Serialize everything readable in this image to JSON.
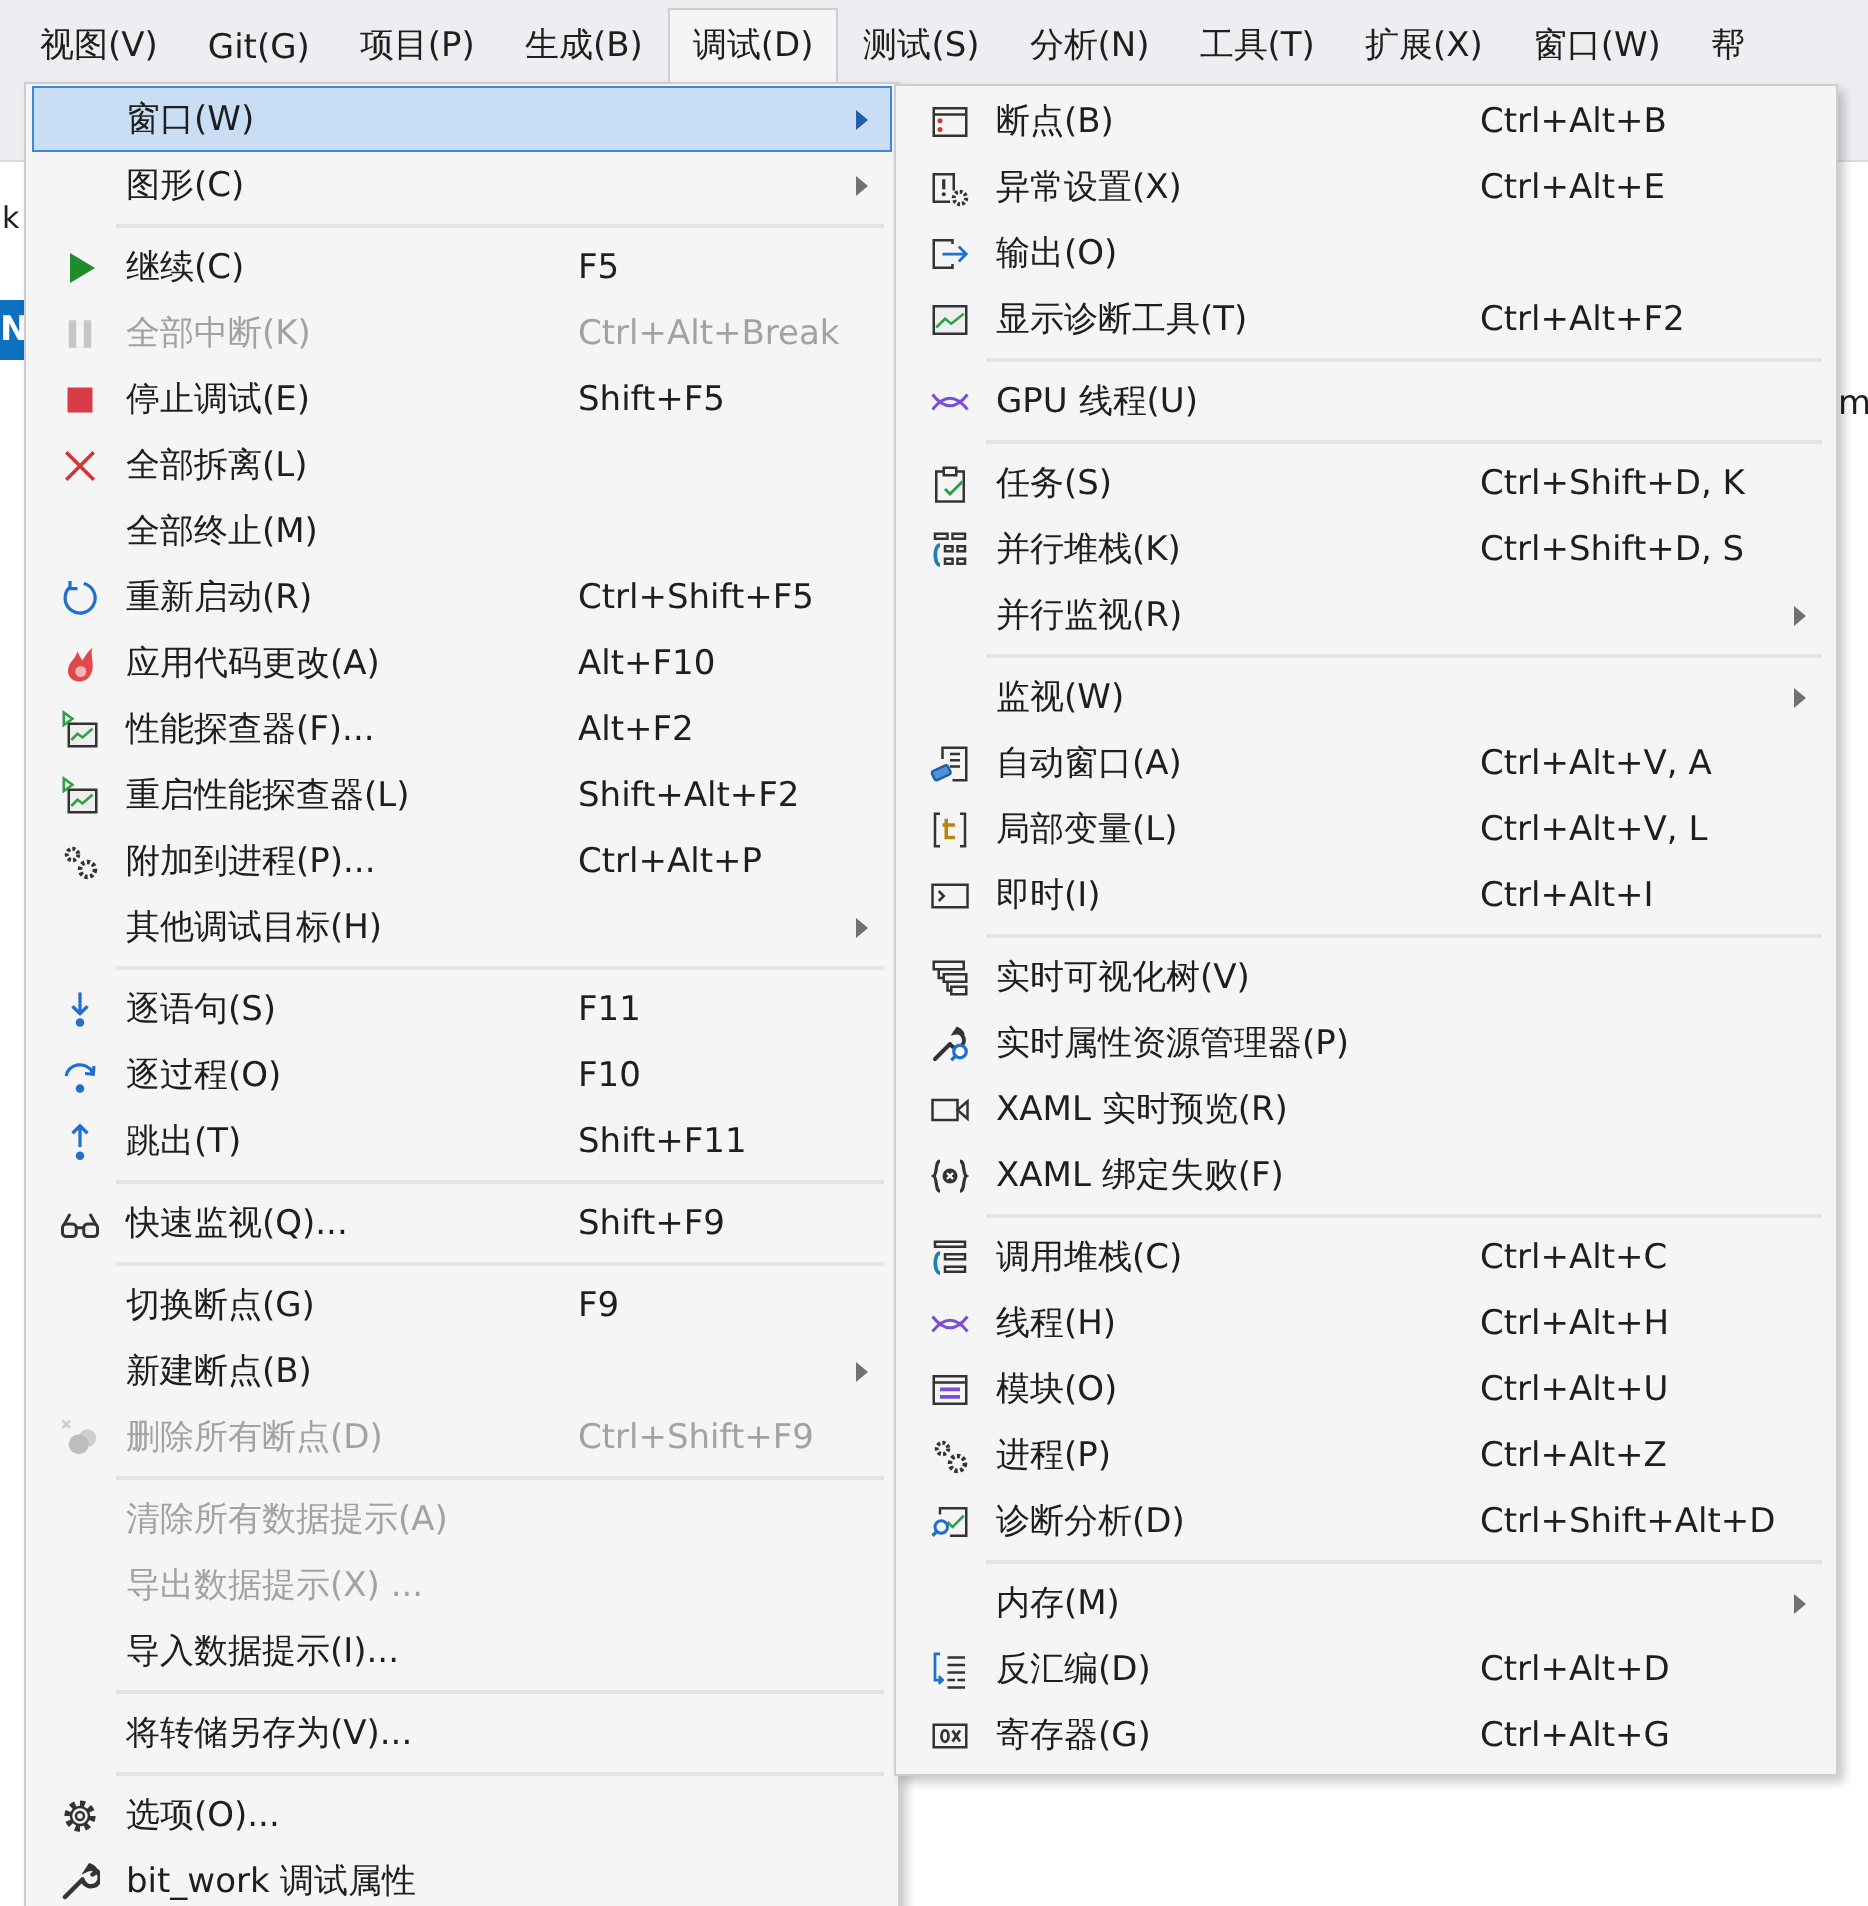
{
  "menubar": [
    {
      "label": "视图(V)",
      "selected": false
    },
    {
      "label": "Git(G)",
      "selected": false
    },
    {
      "label": "项目(P)",
      "selected": false
    },
    {
      "label": "生成(B)",
      "selected": false
    },
    {
      "label": "调试(D)",
      "selected": true
    },
    {
      "label": "测试(S)",
      "selected": false
    },
    {
      "label": "分析(N)",
      "selected": false
    },
    {
      "label": "工具(T)",
      "selected": false
    },
    {
      "label": "扩展(X)",
      "selected": false
    },
    {
      "label": "窗口(W)",
      "selected": false
    },
    {
      "label": "帮",
      "selected": false
    }
  ],
  "background_fragments": [
    "k",
    "N",
    "m"
  ],
  "debug_menu": {
    "items": [
      {
        "kind": "item",
        "label": "窗口(W)",
        "submenu": true,
        "selected": true,
        "disabled": false
      },
      {
        "kind": "item",
        "label": "图形(C)",
        "submenu": true,
        "selected": false,
        "disabled": false
      },
      {
        "kind": "separator"
      },
      {
        "kind": "item",
        "label": "继续(C)",
        "shortcut": "F5",
        "submenu": false,
        "selected": false,
        "disabled": false
      },
      {
        "kind": "item",
        "label": "全部中断(K)",
        "shortcut": "Ctrl+Alt+Break",
        "submenu": false,
        "selected": false,
        "disabled": true
      },
      {
        "kind": "item",
        "label": "停止调试(E)",
        "shortcut": "Shift+F5",
        "submenu": false,
        "selected": false,
        "disabled": false
      },
      {
        "kind": "item",
        "label": "全部拆离(L)",
        "submenu": false,
        "selected": false,
        "disabled": false
      },
      {
        "kind": "item",
        "label": "全部终止(M)",
        "submenu": false,
        "selected": false,
        "disabled": false
      },
      {
        "kind": "item",
        "label": "重新启动(R)",
        "shortcut": "Ctrl+Shift+F5",
        "submenu": false,
        "selected": false,
        "disabled": false
      },
      {
        "kind": "item",
        "label": "应用代码更改(A)",
        "shortcut": "Alt+F10",
        "submenu": false,
        "selected": false,
        "disabled": false
      },
      {
        "kind": "item",
        "label": "性能探查器(F)...",
        "shortcut": "Alt+F2",
        "submenu": false,
        "selected": false,
        "disabled": false
      },
      {
        "kind": "item",
        "label": "重启性能探查器(L)",
        "shortcut": "Shift+Alt+F2",
        "submenu": false,
        "selected": false,
        "disabled": false
      },
      {
        "kind": "item",
        "label": "附加到进程(P)...",
        "shortcut": "Ctrl+Alt+P",
        "submenu": false,
        "selected": false,
        "disabled": false
      },
      {
        "kind": "item",
        "label": "其他调试目标(H)",
        "submenu": true,
        "selected": false,
        "disabled": false
      },
      {
        "kind": "separator"
      },
      {
        "kind": "item",
        "label": "逐语句(S)",
        "shortcut": "F11",
        "submenu": false,
        "selected": false,
        "disabled": false
      },
      {
        "kind": "item",
        "label": "逐过程(O)",
        "shortcut": "F10",
        "submenu": false,
        "selected": false,
        "disabled": false
      },
      {
        "kind": "item",
        "label": "跳出(T)",
        "shortcut": "Shift+F11",
        "submenu": false,
        "selected": false,
        "disabled": false
      },
      {
        "kind": "separator"
      },
      {
        "kind": "item",
        "label": "快速监视(Q)...",
        "shortcut": "Shift+F9",
        "submenu": false,
        "selected": false,
        "disabled": false
      },
      {
        "kind": "separator"
      },
      {
        "kind": "item",
        "label": "切换断点(G)",
        "shortcut": "F9",
        "submenu": false,
        "selected": false,
        "disabled": false
      },
      {
        "kind": "item",
        "label": "新建断点(B)",
        "submenu": true,
        "selected": false,
        "disabled": false
      },
      {
        "kind": "item",
        "label": "删除所有断点(D)",
        "shortcut": "Ctrl+Shift+F9",
        "submenu": false,
        "selected": false,
        "disabled": true
      },
      {
        "kind": "separator"
      },
      {
        "kind": "item",
        "label": "清除所有数据提示(A)",
        "submenu": false,
        "selected": false,
        "disabled": true
      },
      {
        "kind": "item",
        "label": "导出数据提示(X) ...",
        "submenu": false,
        "selected": false,
        "disabled": true
      },
      {
        "kind": "item",
        "label": "导入数据提示(I)...",
        "submenu": false,
        "selected": false,
        "disabled": false
      },
      {
        "kind": "separator"
      },
      {
        "kind": "item",
        "label": "将转储另存为(V)...",
        "submenu": false,
        "selected": false,
        "disabled": false
      },
      {
        "kind": "separator"
      },
      {
        "kind": "item",
        "label": "选项(O)...",
        "submenu": false,
        "selected": false,
        "disabled": false
      },
      {
        "kind": "item",
        "label": "bit_work 调试属性",
        "submenu": false,
        "selected": false,
        "disabled": false
      }
    ]
  },
  "window_submenu": {
    "items": [
      {
        "kind": "item",
        "label": "断点(B)",
        "shortcut": "Ctrl+Alt+B",
        "submenu": false
      },
      {
        "kind": "item",
        "label": "异常设置(X)",
        "shortcut": "Ctrl+Alt+E",
        "submenu": false
      },
      {
        "kind": "item",
        "label": "输出(O)",
        "submenu": false
      },
      {
        "kind": "item",
        "label": "显示诊断工具(T)",
        "shortcut": "Ctrl+Alt+F2",
        "submenu": false
      },
      {
        "kind": "separator"
      },
      {
        "kind": "item",
        "label": "GPU 线程(U)",
        "submenu": false
      },
      {
        "kind": "separator"
      },
      {
        "kind": "item",
        "label": "任务(S)",
        "shortcut": "Ctrl+Shift+D, K",
        "submenu": false
      },
      {
        "kind": "item",
        "label": "并行堆栈(K)",
        "shortcut": "Ctrl+Shift+D, S",
        "submenu": false
      },
      {
        "kind": "item",
        "label": "并行监视(R)",
        "submenu": true
      },
      {
        "kind": "separator"
      },
      {
        "kind": "item",
        "label": "监视(W)",
        "submenu": true
      },
      {
        "kind": "item",
        "label": "自动窗口(A)",
        "shortcut": "Ctrl+Alt+V, A",
        "submenu": false
      },
      {
        "kind": "item",
        "label": "局部变量(L)",
        "shortcut": "Ctrl+Alt+V, L",
        "submenu": false
      },
      {
        "kind": "item",
        "label": "即时(I)",
        "shortcut": "Ctrl+Alt+I",
        "submenu": false
      },
      {
        "kind": "separator"
      },
      {
        "kind": "item",
        "label": "实时可视化树(V)",
        "submenu": false
      },
      {
        "kind": "item",
        "label": "实时属性资源管理器(P)",
        "submenu": false
      },
      {
        "kind": "item",
        "label": "XAML 实时预览(R)",
        "submenu": false
      },
      {
        "kind": "item",
        "label": "XAML 绑定失败(F)",
        "submenu": false
      },
      {
        "kind": "separator"
      },
      {
        "kind": "item",
        "label": "调用堆栈(C)",
        "shortcut": "Ctrl+Alt+C",
        "submenu": false
      },
      {
        "kind": "item",
        "label": "线程(H)",
        "shortcut": "Ctrl+Alt+H",
        "submenu": false
      },
      {
        "kind": "item",
        "label": "模块(O)",
        "shortcut": "Ctrl+Alt+U",
        "submenu": false
      },
      {
        "kind": "item",
        "label": "进程(P)",
        "shortcut": "Ctrl+Alt+Z",
        "submenu": false
      },
      {
        "kind": "item",
        "label": "诊断分析(D)",
        "shortcut": "Ctrl+Shift+Alt+D",
        "submenu": false
      },
      {
        "kind": "separator"
      },
      {
        "kind": "item",
        "label": "内存(M)",
        "submenu": true
      },
      {
        "kind": "item",
        "label": "反汇编(D)",
        "shortcut": "Ctrl+Alt+D",
        "submenu": false
      },
      {
        "kind": "item",
        "label": "寄存器(G)",
        "shortcut": "Ctrl+Alt+G",
        "submenu": false
      }
    ]
  }
}
